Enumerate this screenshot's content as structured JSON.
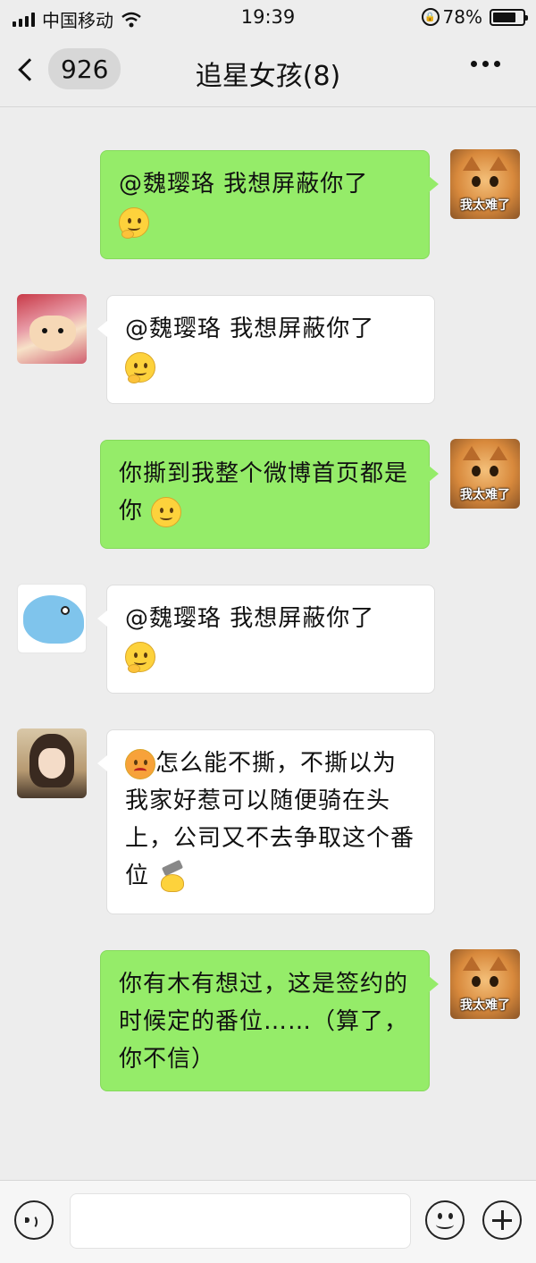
{
  "status_bar": {
    "carrier": "中国移动",
    "time": "19:39",
    "battery_percent": "78%",
    "battery_level": 0.78,
    "signal_icon": "signal-bars-icon",
    "wifi_icon": "wifi-icon",
    "lock_icon": "rotation-lock-icon"
  },
  "nav": {
    "unread_count": "926",
    "title": "追星女孩(8)",
    "back_icon": "chevron-left-icon",
    "more_icon": "more-dots-icon"
  },
  "messages": [
    {
      "side": "out",
      "avatar_caption": "我太难了",
      "text": "@魏璎珞  我想屏蔽你了",
      "emoji": "thinking"
    },
    {
      "side": "in",
      "avatar": "crayon-shin-chan-avatar",
      "text": "@魏璎珞  我想屏蔽你了",
      "emoji": "thinking"
    },
    {
      "side": "out",
      "avatar_caption": "我太难了",
      "text": "你撕到我整个微博首页都是你",
      "emoji": "smile"
    },
    {
      "side": "in",
      "avatar": "dolphin-avatar",
      "text": "@魏璎珞  我想屏蔽你了",
      "emoji": "thinking"
    },
    {
      "side": "in",
      "avatar": "anime-girl-avatar",
      "lead_emoji": "angry",
      "text": "怎么能不撕，不撕以为我家好惹可以随便骑在头上，公司又不去争取这个番位",
      "emoji": "hammer"
    },
    {
      "side": "out",
      "avatar_caption": "我太难了",
      "text": "你有木有想过，这是签约的时候定的番位……（算了，你不信）"
    }
  ],
  "input_bar": {
    "placeholder": "",
    "voice_icon": "voice-icon",
    "emoji_icon": "emoji-icon",
    "plus_icon": "plus-icon"
  },
  "colors": {
    "background": "#ededed",
    "outgoing_bubble": "#95ec69",
    "incoming_bubble": "#ffffff"
  }
}
